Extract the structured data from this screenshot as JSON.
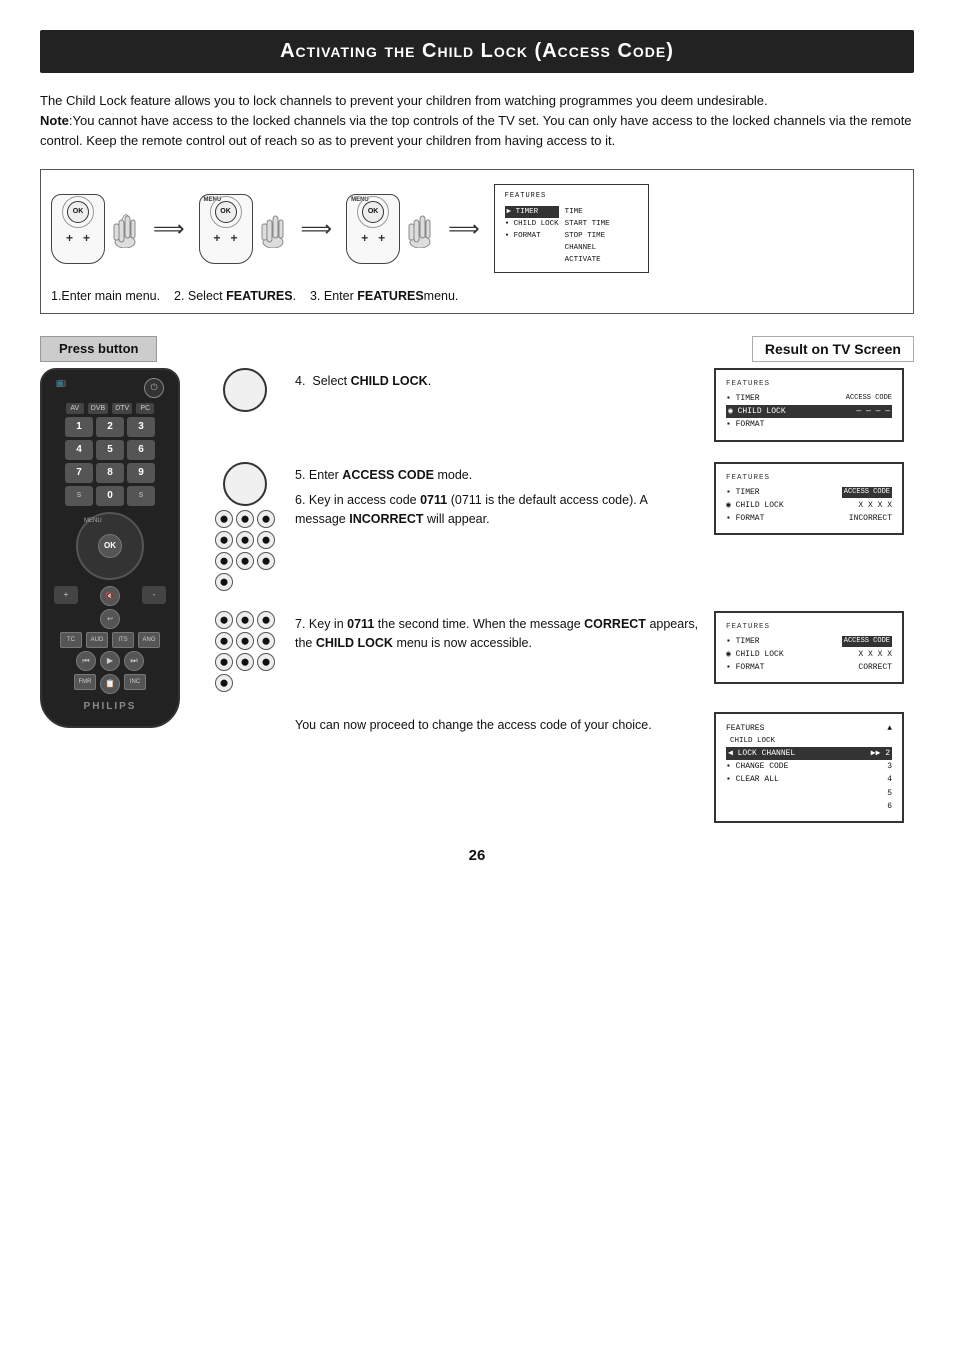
{
  "page": {
    "title": "Activating the Child Lock (Access Code)",
    "number": "26"
  },
  "intro": {
    "paragraph1": "The Child Lock feature allows you to lock channels to prevent your children from watching programmes you deem undesirable.",
    "note_label": "Note",
    "note_text": ":You cannot have access to the locked channels via the top controls of the TV set. You can only have access to the locked channels via the remote control. Keep the remote control out of reach so as to prevent your children from having access to it."
  },
  "top_steps": {
    "step1": "1.Enter main menu.",
    "step2": "2. Select",
    "step2_bold": "FEATURES",
    "step2_end": ".",
    "step3": "3. Enter",
    "step3_bold": "FEATURES",
    "step3_end": "menu."
  },
  "top_screen": {
    "title": "FEATURES",
    "item1": "▶ TIMER",
    "item1_right1": "TIME",
    "item1_right2": "START TIME",
    "item1_right3": "STOP TIME",
    "item1_right4": "CHANNEL",
    "item1_right5": "ACTIVATE",
    "item2": "▪ CHILD LOCK",
    "item3": "▪ FORMAT"
  },
  "headers": {
    "press_button": "Press button",
    "result_on_tv": "Result on TV Screen"
  },
  "steps": [
    {
      "id": "step4",
      "number": "4.",
      "instruction": "Select",
      "bold": "CHILD LOCK",
      "end": ".",
      "screen": {
        "title": "FEATURES",
        "rows": [
          {
            "text": "▪ TIMER",
            "right": "ACCESS CODE",
            "highlighted": false
          },
          {
            "text": "◉ CHILD LOCK",
            "right": "— — — —",
            "highlighted": true
          },
          {
            "text": "▪ FORMAT",
            "right": "",
            "highlighted": false
          }
        ]
      }
    },
    {
      "id": "step5-6",
      "number5": "5.",
      "instruction5": "Enter",
      "bold5": "ACCESS CODE",
      "end5": "mode.",
      "number6": "6.",
      "instruction6": "Key in access code",
      "bold6": "0711",
      "detail6": "(0711 is the default access code). A message",
      "bold6b": "INCORRECT",
      "end6": "will appear.",
      "screen": {
        "title": "FEATURES",
        "rows": [
          {
            "text": "▪ TIMER",
            "right": "ACCESS CODE",
            "highlighted": false,
            "right_highlighted": true
          },
          {
            "text": "◉ CHILD LOCK",
            "right": "X X X X",
            "highlighted": false
          },
          {
            "text": "▪ FORMAT",
            "right": "INCORRECT",
            "highlighted": false
          }
        ]
      }
    },
    {
      "id": "step7",
      "number": "7.",
      "instruction": "Key in",
      "bold1": "0711",
      "middle": "the second time. When the message",
      "bold2": "CORRECT",
      "middle2": "appears, the",
      "bold3": "CHILD LOCK",
      "end": "menu is now accessible.",
      "screen": {
        "title": "FEATURES",
        "rows": [
          {
            "text": "▪ TIMER",
            "right": "ACCESS CODE",
            "highlighted": false,
            "right_highlighted": true
          },
          {
            "text": "◉ CHILD LOCK",
            "right": "X X X X",
            "highlighted": false
          },
          {
            "text": "▪ FORMAT",
            "right": "CORRECT",
            "highlighted": false
          }
        ]
      }
    }
  ],
  "bottom_step": {
    "text1": "You can now proceed to change the access code of your choice.",
    "screen": {
      "title": "FEATURES",
      "subtitle": "  CHILD LOCK",
      "rows": [
        {
          "text": "◀ LOCK CHANNEL",
          "right": "▶▶ 2",
          "highlighted": true
        },
        {
          "text": "▪ CHANGE CODE",
          "right": "3",
          "highlighted": false
        },
        {
          "text": "▪ CLEAR ALL",
          "right": "4",
          "highlighted": false
        },
        {
          "text": "",
          "right": "5",
          "highlighted": false
        },
        {
          "text": "",
          "right": "6",
          "highlighted": false
        }
      ],
      "top_right": "▲"
    }
  },
  "remote": {
    "brand": "PHILIPS",
    "buttons": {
      "numbers": [
        "1",
        "2",
        "3",
        "4",
        "5",
        "6",
        "7",
        "8",
        "9",
        "⬦",
        "0",
        "⬦"
      ],
      "nav_label": "OK",
      "menu_label": "MENU"
    }
  }
}
